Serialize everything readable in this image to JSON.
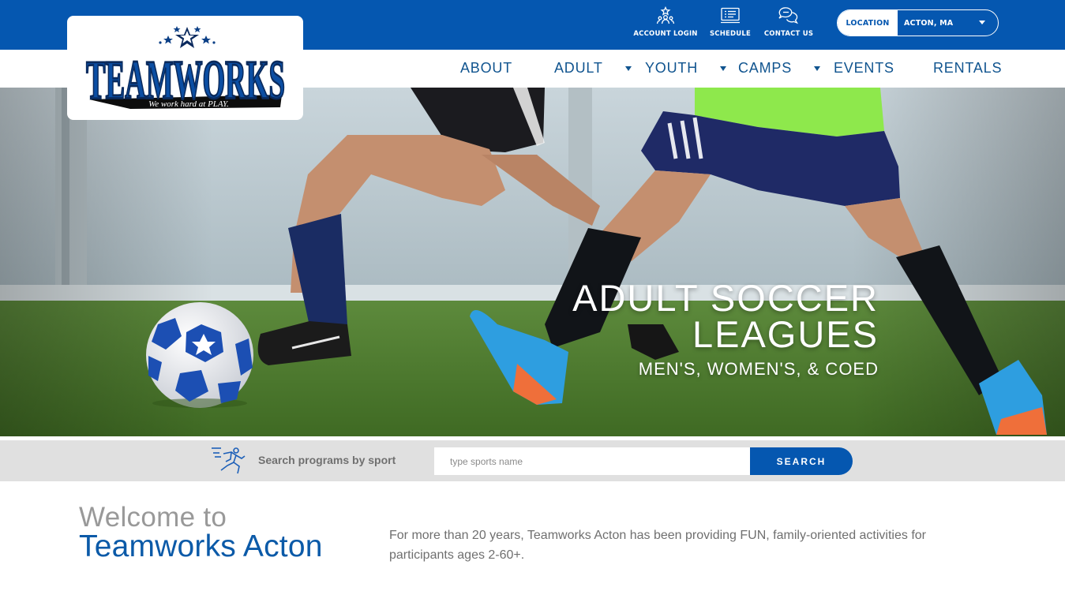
{
  "header": {
    "utility_links": [
      {
        "label": "ACCOUNT LOGIN",
        "icon": "account-login-icon"
      },
      {
        "label": "SCHEDULE",
        "icon": "schedule-icon"
      },
      {
        "label": "CONTACT US",
        "icon": "contact-chat-icon"
      }
    ],
    "location": {
      "label": "LOCATION",
      "value": "ACTON, MA"
    }
  },
  "logo": {
    "brand": "TEAMWORKS",
    "tagline": "We work hard at PLAY."
  },
  "nav": [
    {
      "label": "ABOUT",
      "has_dropdown": false
    },
    {
      "label": "ADULT",
      "has_dropdown": true
    },
    {
      "label": "YOUTH",
      "has_dropdown": true
    },
    {
      "label": "CAMPS",
      "has_dropdown": true
    },
    {
      "label": "EVENTS",
      "has_dropdown": false
    },
    {
      "label": "RENTALS",
      "has_dropdown": false
    }
  ],
  "hero": {
    "title_line1": "ADULT SOCCER",
    "title_line2": "LEAGUES",
    "subtitle": "MEN'S, WOMEN'S, & COED"
  },
  "search": {
    "label": "Search programs by sport",
    "placeholder": "type sports name",
    "button_label": "SEARCH"
  },
  "welcome": {
    "pre": "Welcome to",
    "title": "Teamworks Acton",
    "body": "For more than 20 years, Teamworks Acton has been providing FUN, family-oriented activities for participants ages 2-60+."
  },
  "colors": {
    "brand_blue": "#0557b0",
    "nav_text": "#10548f",
    "turf_green": "#4d7a2b",
    "search_strip": "#e0e0e0"
  }
}
